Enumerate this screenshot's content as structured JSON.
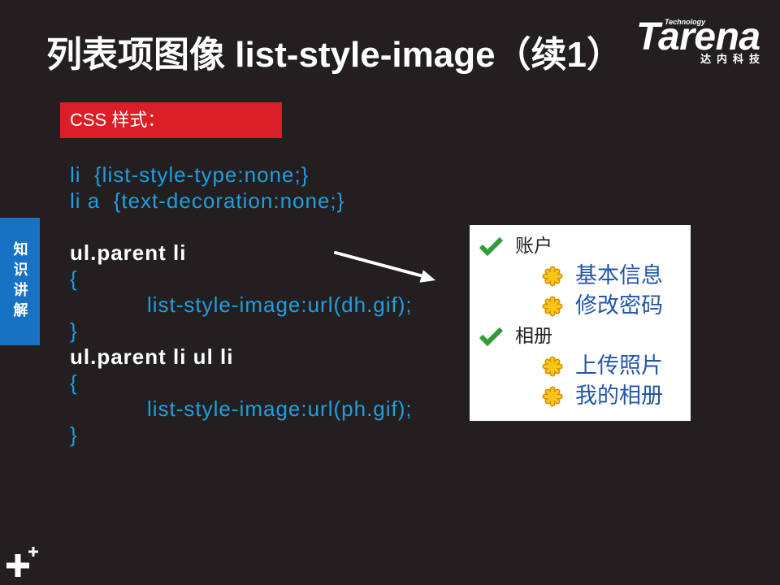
{
  "slide": {
    "title": "列表项图像 list-style-image（续1）",
    "section_tab": "知识讲解",
    "style_heading": "CSS 样式："
  },
  "logo": {
    "brand": "Tarena",
    "tagline": "Technology",
    "cn_name": "达内科技"
  },
  "code": {
    "lines": [
      "li  {list-style-type:none;}",
      "li a  {text-decoration:none;}",
      "ul.parent li",
      "{",
      "list-style-image:url(dh.gif);",
      "}",
      "ul.parent li ul li",
      "{",
      "list-style-image:url(ph.gif);",
      "}"
    ]
  },
  "preview": {
    "groups": [
      {
        "label": "账户",
        "items": [
          "基本信息",
          "修改密码"
        ]
      },
      {
        "label": "相册",
        "items": [
          "上传照片",
          "我的相册"
        ]
      }
    ]
  },
  "icons": {
    "group_bullet": "check-icon",
    "item_bullet": "gear-icon",
    "pointer": "arrow-icon",
    "corner_mark": "plus-icon"
  },
  "colors": {
    "background": "#231f20",
    "heading_box": "#dc1f26",
    "section_tab": "#1872c4",
    "code_text": "#1e9fdf",
    "selector_text": "#ffffff",
    "preview_item_text": "#2456a6",
    "check_green": "#2f9d3a",
    "gear_yellow": "#f6c619"
  }
}
